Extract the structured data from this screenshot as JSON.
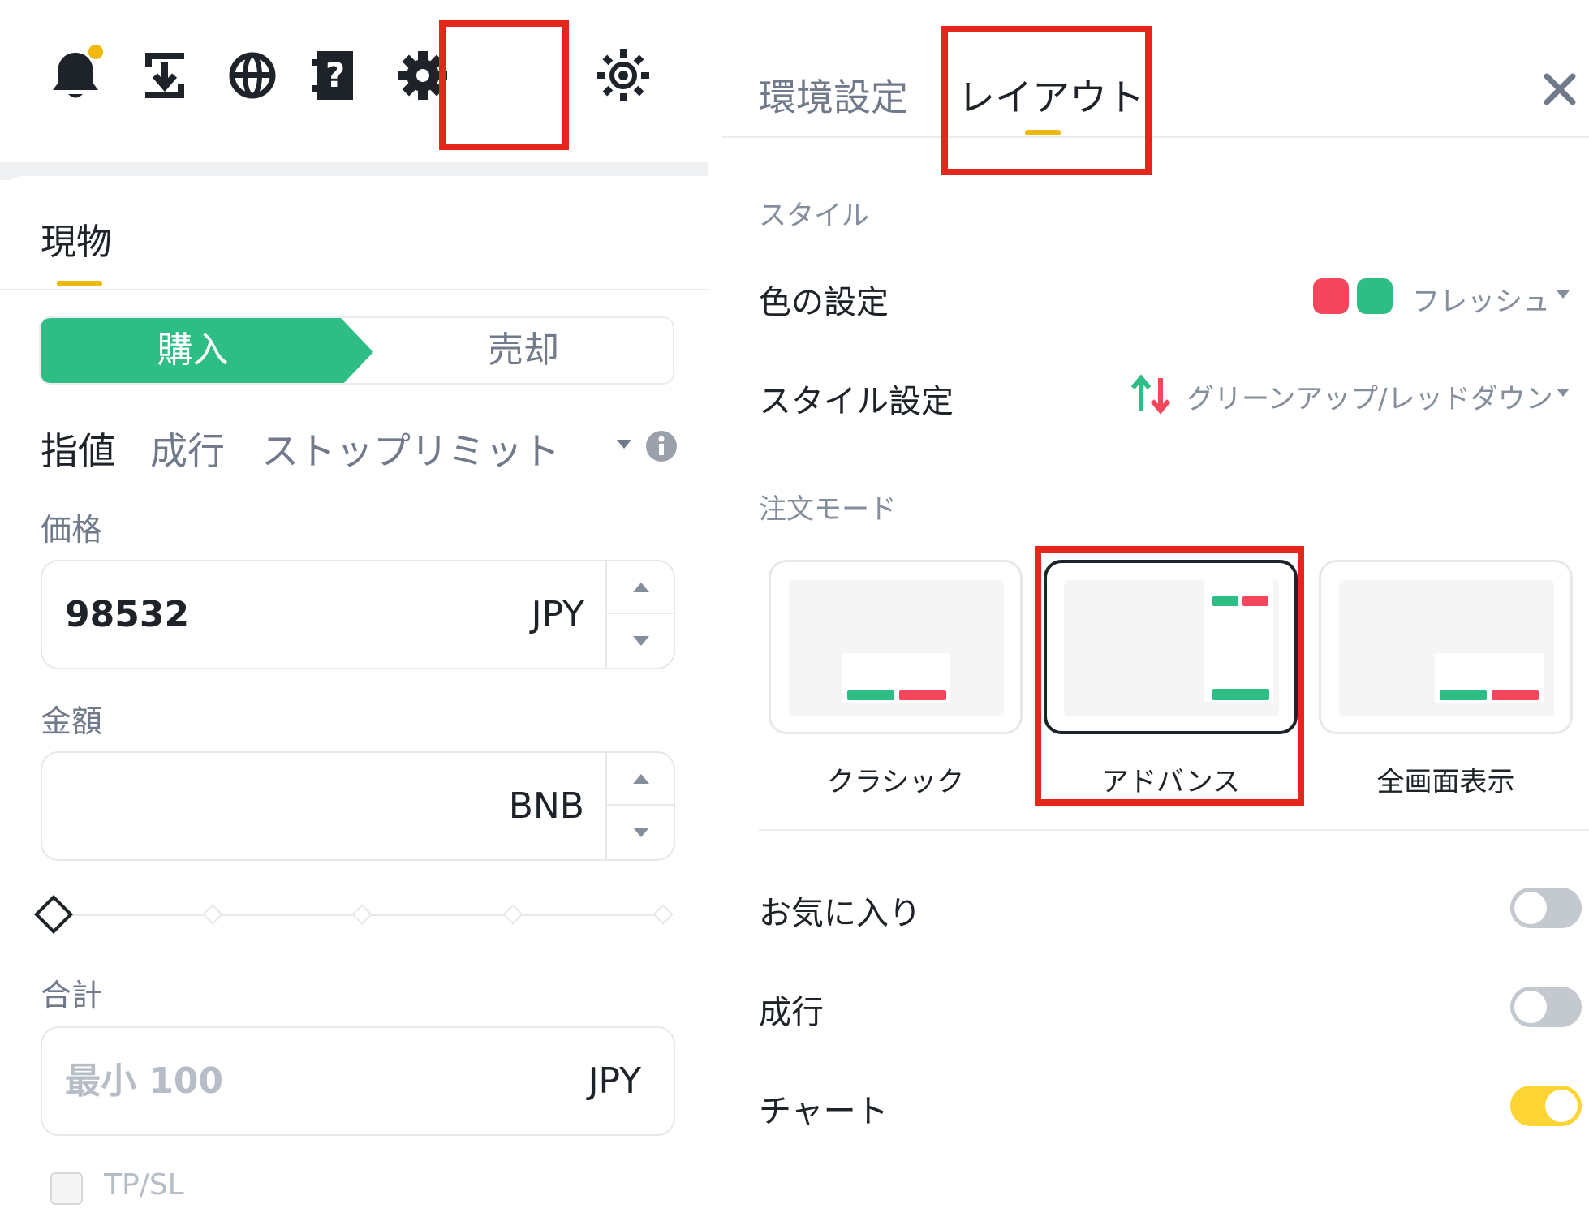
{
  "colors": {
    "accent": "#f0b90b",
    "buy_green": "#2ebd85",
    "sell_red": "#f6465d",
    "highlight_red": "#e4271b",
    "toggle_on": "#fcd535",
    "toggle_off": "#c4c9cf"
  },
  "header_icons": [
    "bell-icon",
    "download-icon",
    "globe-icon",
    "help-icon",
    "gear-icon",
    "theme-icon"
  ],
  "left": {
    "tab_spot": "現物",
    "buy_label": "購入",
    "sell_label": "売却",
    "order_types": {
      "limit": "指値",
      "market": "成行",
      "stop_limit": "ストップリミット"
    },
    "price": {
      "label": "価格",
      "value": "98532",
      "unit": "JPY"
    },
    "amount": {
      "label": "金額",
      "value": "",
      "unit": "BNB"
    },
    "slider": {
      "level": 0
    },
    "total": {
      "label": "合計",
      "placeholder": "最小 100",
      "unit": "JPY"
    },
    "tpsl_label": "TP/SL"
  },
  "right": {
    "tabs": {
      "environment": "環境設定",
      "layout": "レイアウト"
    },
    "style_section": "スタイル",
    "color_setting": {
      "label": "色の設定",
      "value": "フレッシュ",
      "swatch_up": "#f6465d",
      "swatch_down": "#2ebd85"
    },
    "style_setting": {
      "label": "スタイル設定",
      "value": "グリーンアップ/レッドダウン"
    },
    "order_mode_section": "注文モード",
    "order_modes": [
      {
        "label": "クラシック",
        "selected": false
      },
      {
        "label": "アドバンス",
        "selected": true
      },
      {
        "label": "全画面表示",
        "selected": false
      }
    ],
    "toggles": [
      {
        "label": "お気に入り",
        "on": false
      },
      {
        "label": "成行",
        "on": false
      },
      {
        "label": "チャート",
        "on": true
      }
    ]
  }
}
